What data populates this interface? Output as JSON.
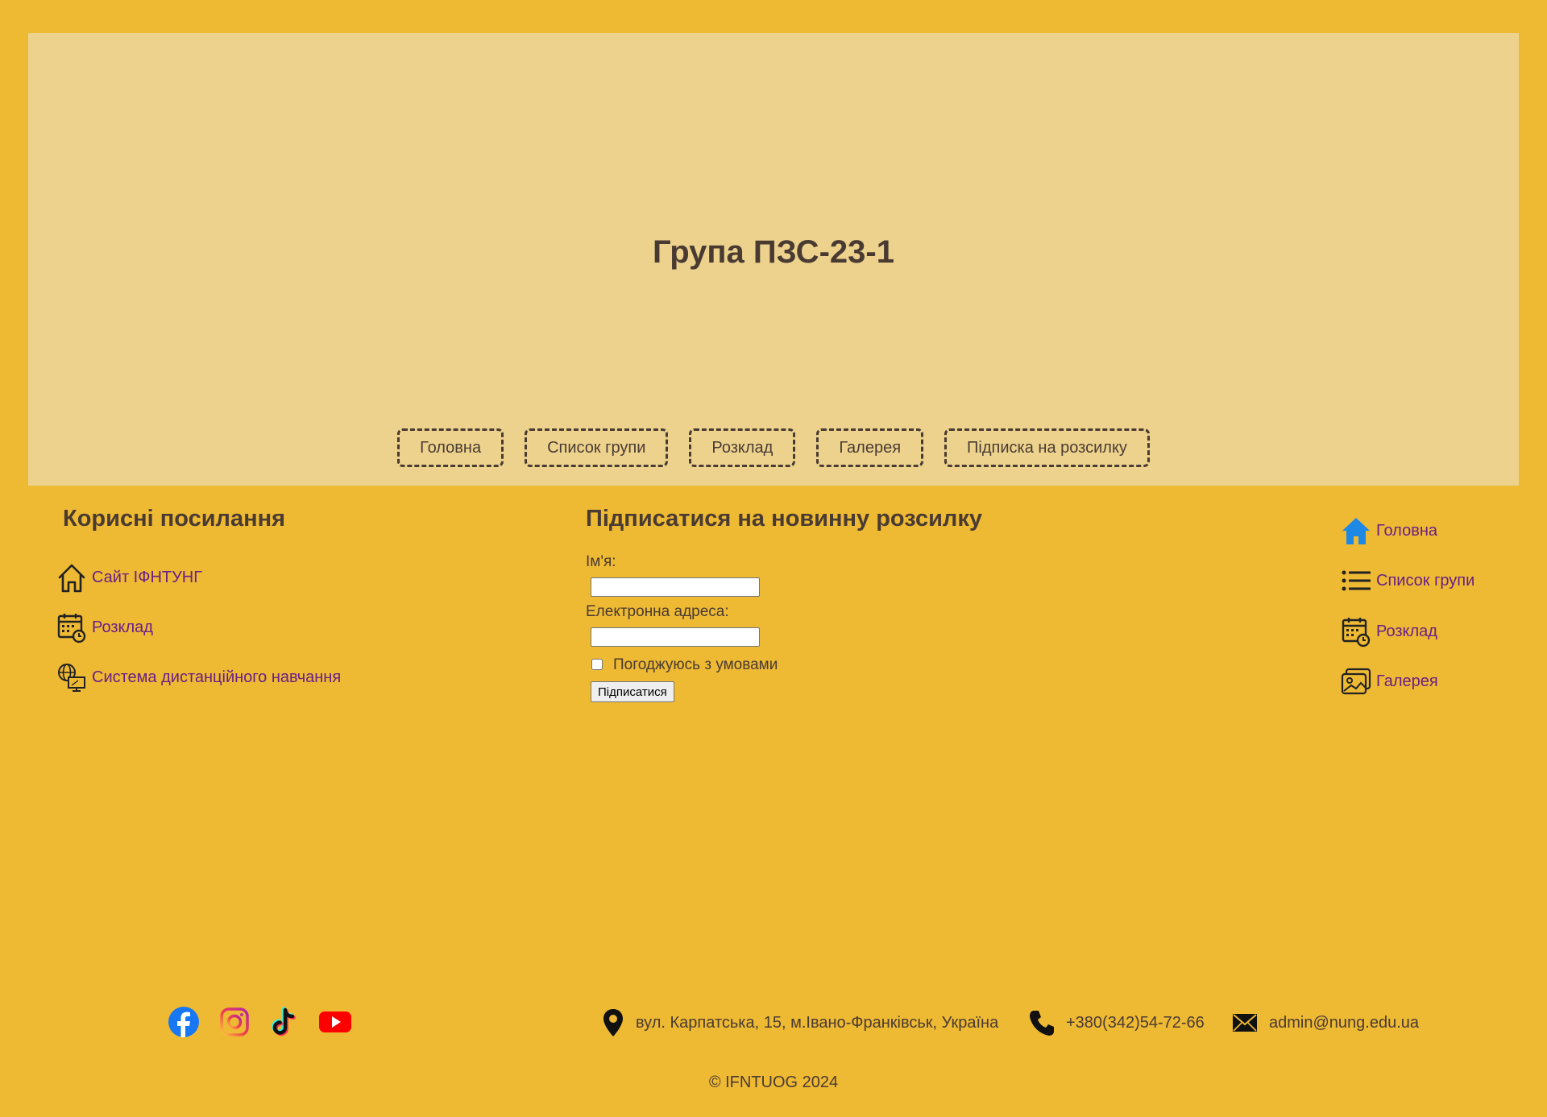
{
  "header": {
    "title": "Група ПЗС-23-1",
    "nav": [
      "Головна",
      "Список групи",
      "Розклад",
      "Галерея",
      "Підписка на розсилку"
    ]
  },
  "useful_links": {
    "heading": "Корисні посилання",
    "items": [
      {
        "label": "Сайт ІФНТУНГ",
        "icon": "home-outline-icon"
      },
      {
        "label": "Розклад",
        "icon": "calendar-clock-icon"
      },
      {
        "label": "Система дистанційного навчання",
        "icon": "globe-monitor-icon"
      }
    ]
  },
  "subscribe": {
    "heading": "Підписатися на новинну розсилку",
    "name_label": "Ім'я:",
    "name_value": "",
    "email_label": "Електронна адреса:",
    "email_value": "",
    "agree_label": "Погоджуюсь з умовами",
    "agree_checked": false,
    "submit_label": "Підписатися"
  },
  "side_nav": {
    "items": [
      {
        "label": "Головна",
        "icon": "home-filled-icon"
      },
      {
        "label": "Список групи",
        "icon": "list-icon"
      },
      {
        "label": "Розклад",
        "icon": "calendar-clock-icon"
      },
      {
        "label": "Галерея",
        "icon": "gallery-icon"
      }
    ]
  },
  "footer": {
    "social": [
      "facebook-icon",
      "instagram-icon",
      "tiktok-icon",
      "youtube-icon"
    ],
    "address": "вул. Карпатська, 15, м.Івано-Франківськ, Україна",
    "phone": "+380(342)54-72-66",
    "email": "admin@nung.edu.ua",
    "copyright": "© IFNTUOG 2024"
  },
  "colors": {
    "background": "#EEB933",
    "header_bg": "#EDD28E",
    "text": "#4a3b32",
    "link": "#6a1f86",
    "home_icon_blue": "#1e88e5"
  }
}
